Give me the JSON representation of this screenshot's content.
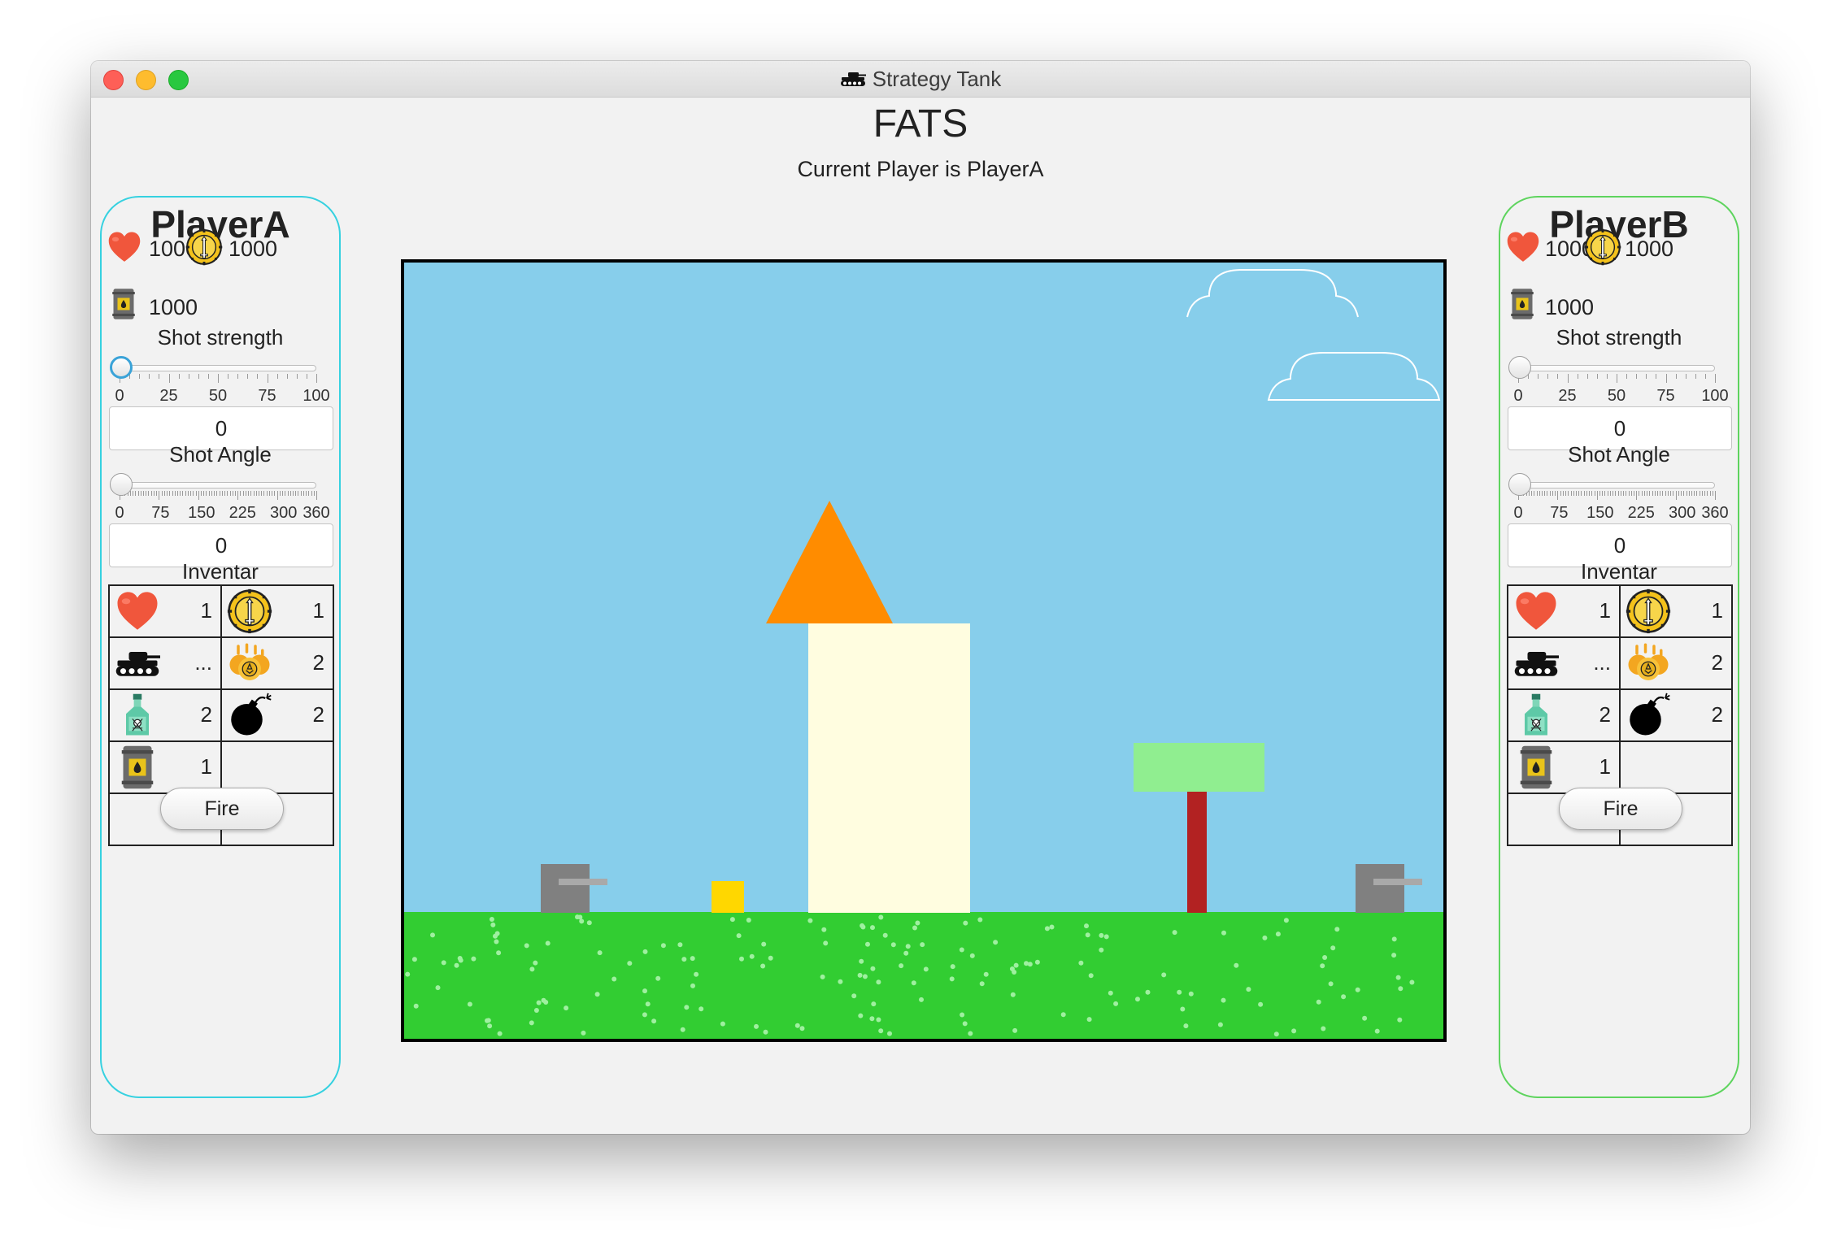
{
  "window": {
    "title": "Strategy Tank",
    "title_icon": "tank-icon"
  },
  "header": {
    "title": "FATS",
    "status": "Current Player is PlayerA"
  },
  "players": [
    {
      "name": "PlayerA",
      "health": "1000",
      "money": "1000",
      "fuel": "1000",
      "shot_strength_label": "Shot strength",
      "strength_ticks": [
        "0",
        "25",
        "50",
        "75",
        "100"
      ],
      "strength_value": "0",
      "shot_angle_label": "Shot Angle",
      "angle_ticks": [
        "0",
        "75",
        "150",
        "225",
        "300",
        "360"
      ],
      "angle_value": "0",
      "inventory_label": "Inventar",
      "inventory": [
        {
          "icon": "heart-icon",
          "count": "1"
        },
        {
          "icon": "coin-icon",
          "count": "1"
        },
        {
          "icon": "tank-icon",
          "count": "..."
        },
        {
          "icon": "explosion-icon",
          "count": "2"
        },
        {
          "icon": "poison-bottle-icon",
          "count": "2"
        },
        {
          "icon": "bomb-icon",
          "count": "2"
        },
        {
          "icon": "fuel-barrel-icon",
          "count": "1"
        },
        {
          "icon": "",
          "count": ""
        },
        {
          "icon": "",
          "count": ""
        },
        {
          "icon": "",
          "count": ""
        }
      ],
      "fire_label": "Fire"
    },
    {
      "name": "PlayerB",
      "health": "1000",
      "money": "1000",
      "fuel": "1000",
      "shot_strength_label": "Shot strength",
      "strength_ticks": [
        "0",
        "25",
        "50",
        "75",
        "100"
      ],
      "strength_value": "0",
      "shot_angle_label": "Shot Angle",
      "angle_ticks": [
        "0",
        "75",
        "150",
        "225",
        "300",
        "360"
      ],
      "angle_value": "0",
      "inventory_label": "Inventar",
      "inventory": [
        {
          "icon": "heart-icon",
          "count": "1"
        },
        {
          "icon": "coin-icon",
          "count": "1"
        },
        {
          "icon": "tank-icon",
          "count": "..."
        },
        {
          "icon": "explosion-icon",
          "count": "2"
        },
        {
          "icon": "poison-bottle-icon",
          "count": "2"
        },
        {
          "icon": "bomb-icon",
          "count": "2"
        },
        {
          "icon": "fuel-barrel-icon",
          "count": "1"
        },
        {
          "icon": "",
          "count": ""
        },
        {
          "icon": "",
          "count": ""
        },
        {
          "icon": "",
          "count": ""
        }
      ],
      "fire_label": "Fire"
    }
  ],
  "colors": {
    "panel_a_border": "#36d1e0",
    "panel_b_border": "#5ed45e",
    "sky": "#87ceeb",
    "grass": "#32cd32",
    "roof": "#ff8c00",
    "house": "#fffde0",
    "tree_top": "#90ee90",
    "tree_trunk": "#b22222",
    "tank": "#808080",
    "crate": "#ffd700"
  }
}
